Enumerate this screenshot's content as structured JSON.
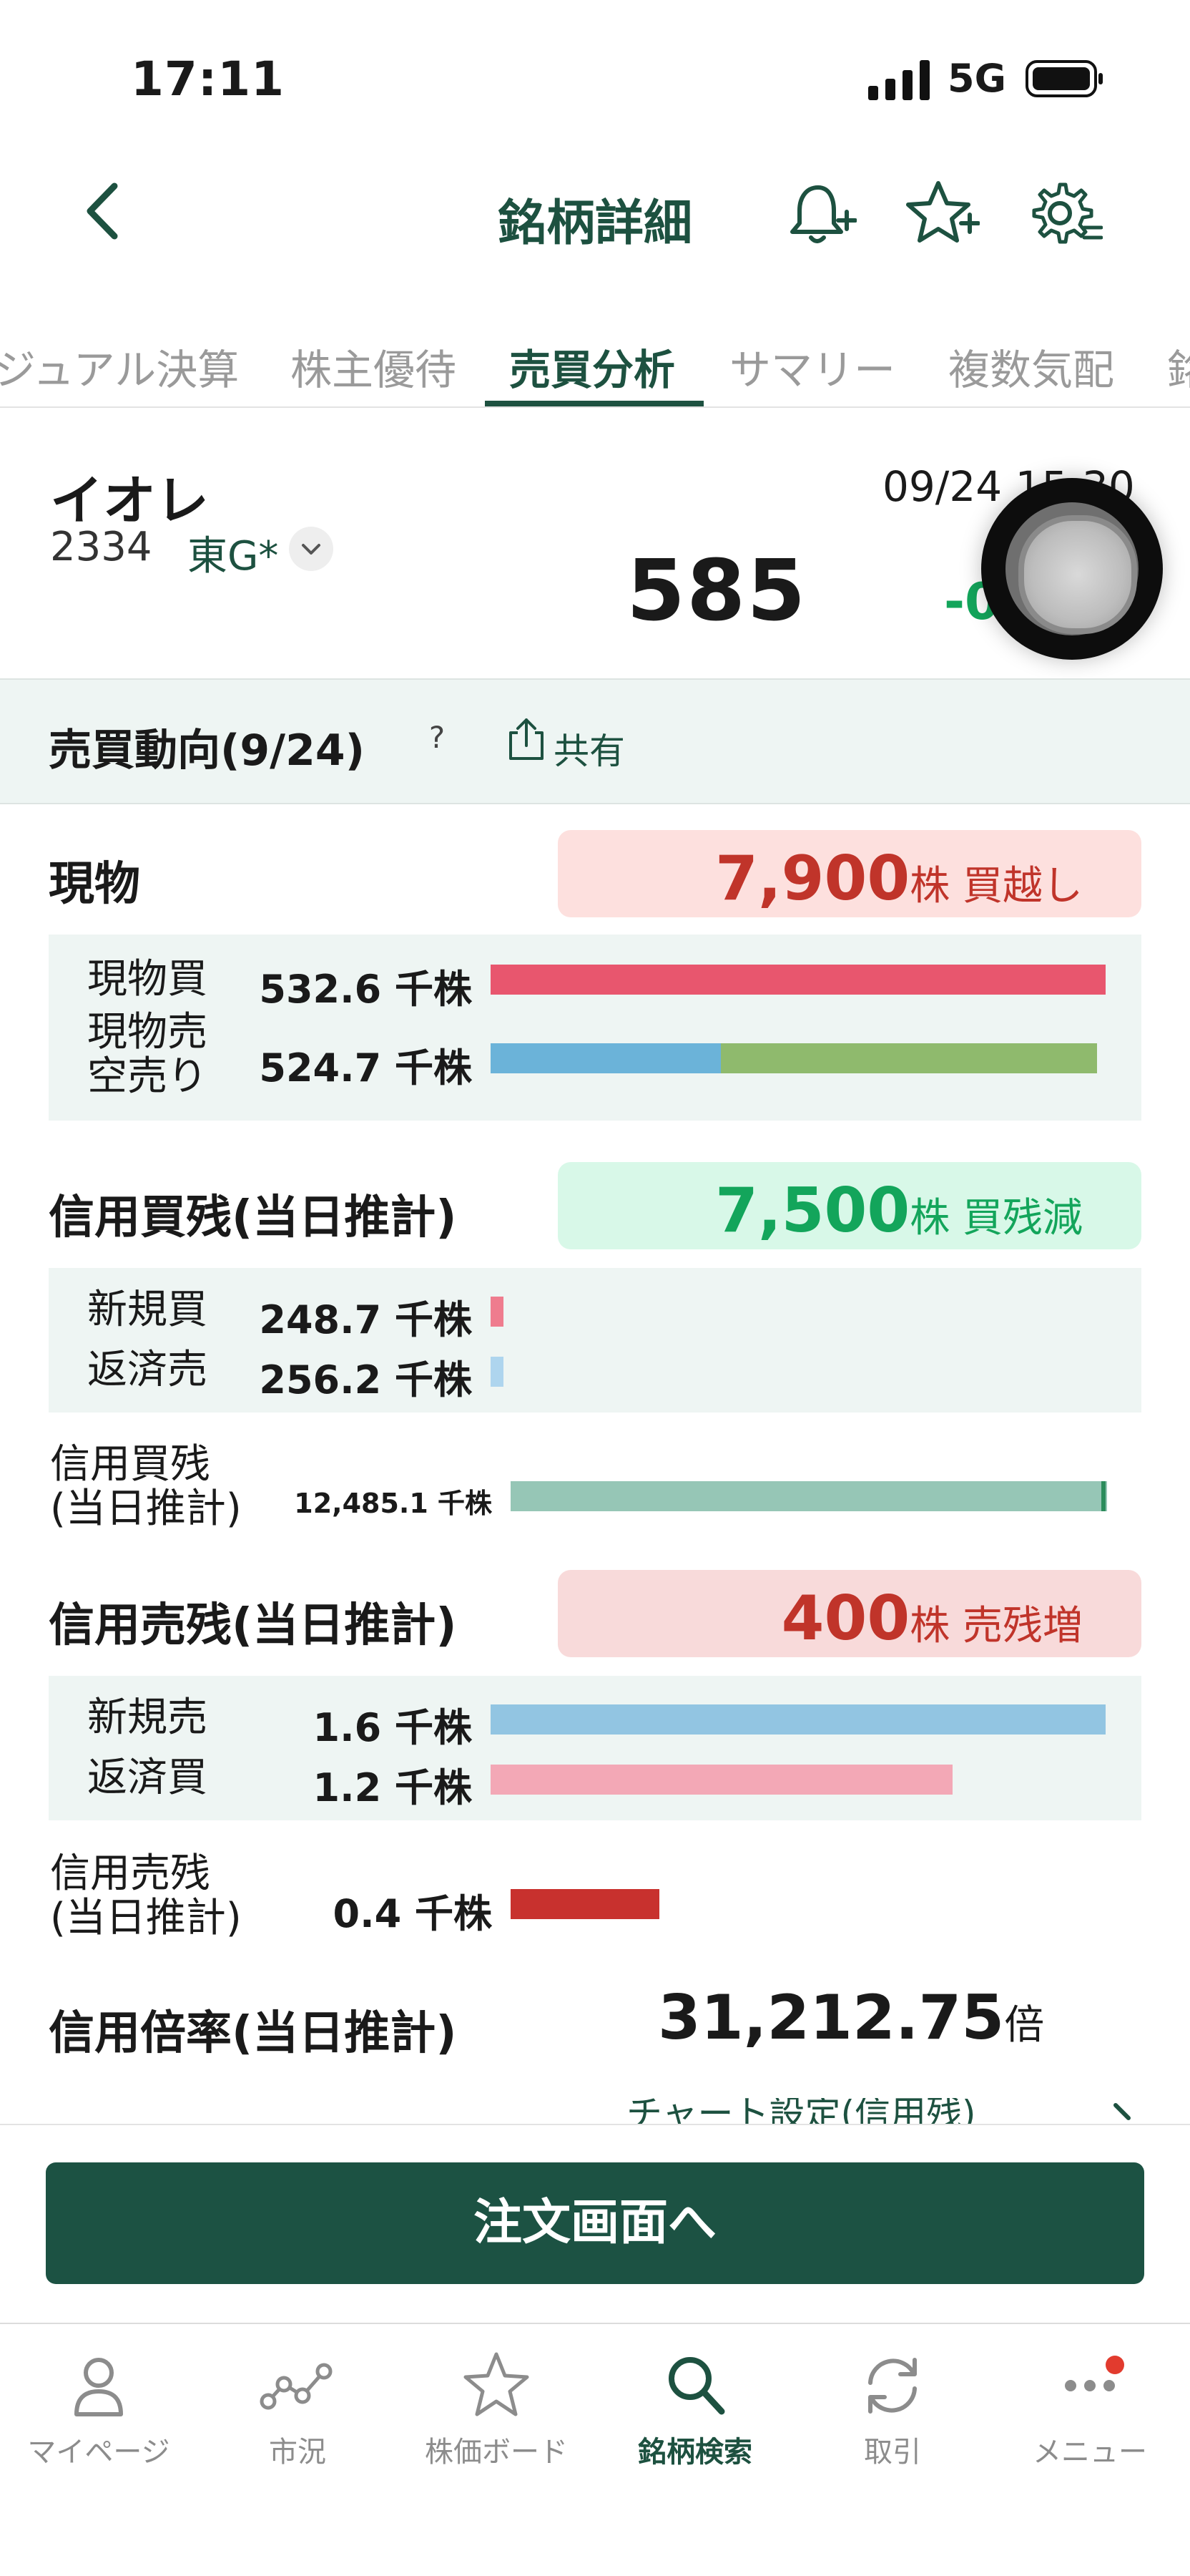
{
  "status": {
    "time": "17:11",
    "network": "5G"
  },
  "header": {
    "title": "銘柄詳細"
  },
  "tabs": [
    {
      "label": "ジュアル決算"
    },
    {
      "label": "株主優待"
    },
    {
      "label": "売買分析"
    },
    {
      "label": "サマリー"
    },
    {
      "label": "複数気配"
    },
    {
      "label": "銘"
    }
  ],
  "stock": {
    "name": "イオレ",
    "code": "2334",
    "market": "東G*",
    "datetime": "09/24 15:30",
    "price": "585",
    "change": "-0"
  },
  "section": {
    "title": "売買動向(9/24)",
    "help": "?",
    "share": "共有"
  },
  "spot": {
    "title": "現物",
    "summary_value": "7,900",
    "summary_unit": "株 買越し",
    "rows": [
      {
        "label": "現物買",
        "value": "532.6 千株"
      },
      {
        "label": "現物売\n空売り",
        "value": "524.7 千株"
      }
    ],
    "bars": {
      "buy": 1.0,
      "sell_blue": 0.374,
      "sell_green": 0.611
    }
  },
  "margin_buy": {
    "title": "信用買残(当日推計)",
    "summary_value": "7,500",
    "summary_unit": "株 買残減",
    "rows": [
      {
        "label": "新規買",
        "value": "248.7 千株"
      },
      {
        "label": "返済売",
        "value": "256.2 千株"
      }
    ],
    "balance_label": "信用買残\n(当日推計)",
    "balance_value": "12,485.1 千株",
    "bars": {
      "new": 0.022,
      "repay": 0.022,
      "balance": 1.0
    }
  },
  "margin_sell": {
    "title": "信用売残(当日推計)",
    "summary_value": "400",
    "summary_unit": "株 売残増",
    "rows": [
      {
        "label": "新規売",
        "value": "1.6 千株"
      },
      {
        "label": "返済買",
        "value": "1.2 千株"
      }
    ],
    "balance_label": "信用売残\n(当日推計)",
    "balance_value": "0.4 千株",
    "bars": {
      "new": 1.0,
      "repay": 0.75,
      "balance": 0.25
    }
  },
  "ratio": {
    "title": "信用倍率(当日推計)",
    "value": "31,212.75",
    "unit": "倍"
  },
  "chart_link": "チャート設定(信用残)",
  "order_button": "注文画面へ",
  "nav": [
    {
      "label": "マイページ",
      "icon": "person-icon"
    },
    {
      "label": "市況",
      "icon": "market-chart-icon"
    },
    {
      "label": "株価ボード",
      "icon": "star-icon"
    },
    {
      "label": "銘柄検索",
      "icon": "search-icon"
    },
    {
      "label": "取引",
      "icon": "refresh-icon"
    },
    {
      "label": "メニュー",
      "icon": "more-icon"
    }
  ],
  "colors": {
    "brand": "#1d5140",
    "buy_bar": "#e8566e",
    "sell_blue": "#6bb3d9",
    "sell_green": "#8fba6d",
    "pill_red_bg": "#fde0de",
    "pill_green_bg": "#d8f8e8",
    "red_text": "#c0342a",
    "green_text": "#13a55b"
  }
}
